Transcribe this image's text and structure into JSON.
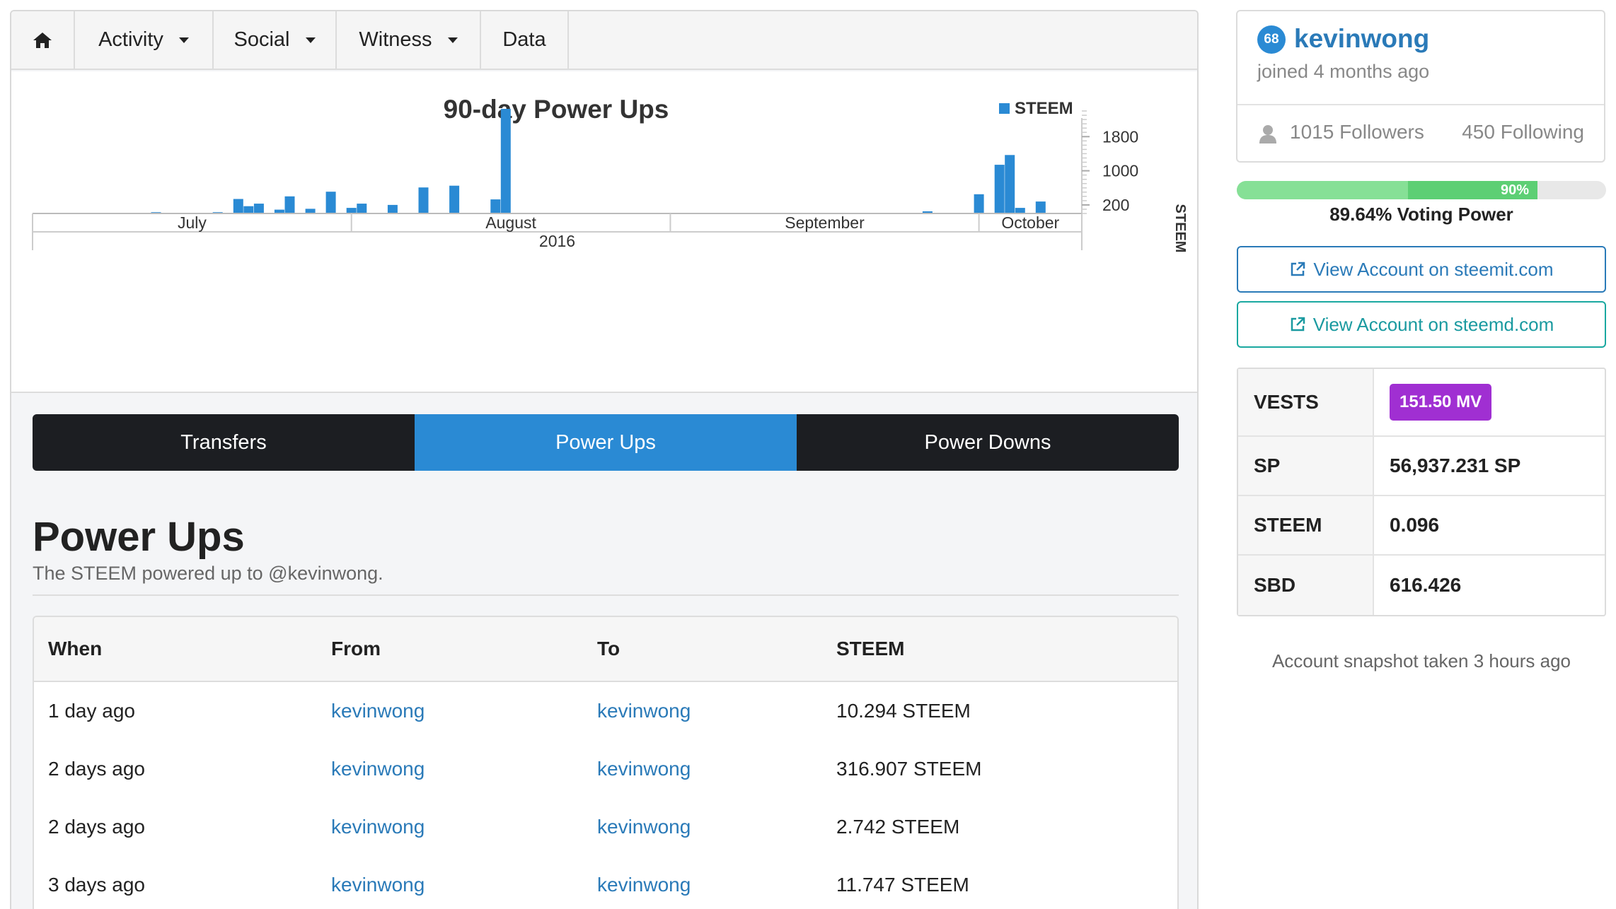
{
  "nav": {
    "home_icon": "home-icon",
    "items": [
      {
        "label": "Activity",
        "dropdown": true
      },
      {
        "label": "Social",
        "dropdown": true
      },
      {
        "label": "Witness",
        "dropdown": true
      },
      {
        "label": "Data",
        "dropdown": false
      }
    ]
  },
  "chart_data": {
    "type": "bar",
    "title": "90-day Power Ups",
    "legend": "STEEM",
    "legend_position": "top-right",
    "ylabel": "STEEM",
    "yticks": [
      200,
      1000,
      1800
    ],
    "ylim": [
      0,
      2500
    ],
    "x_month_labels": [
      "July",
      "August",
      "September",
      "October"
    ],
    "x_year_label": "2016",
    "x": [
      "2016-07-13",
      "2016-07-19",
      "2016-07-21",
      "2016-07-22",
      "2016-07-23",
      "2016-07-25",
      "2016-07-26",
      "2016-07-28",
      "2016-07-30",
      "2016-08-01",
      "2016-08-02",
      "2016-08-05",
      "2016-08-08",
      "2016-08-11",
      "2016-08-15",
      "2016-08-16",
      "2016-09-26",
      "2016-10-01",
      "2016-10-03",
      "2016-10-04",
      "2016-10-05",
      "2016-10-07"
    ],
    "values": [
      30,
      30,
      340,
      170,
      230,
      90,
      400,
      110,
      510,
      130,
      230,
      200,
      610,
      650,
      330,
      2450,
      50,
      450,
      1140,
      1370,
      130,
      280
    ],
    "color": "#2a8ad4",
    "grid": false
  },
  "tabs": [
    "Transfers",
    "Power Ups",
    "Power Downs"
  ],
  "active_tab": "Power Ups",
  "section": {
    "title": "Power Ups",
    "subtitle": "The STEEM powered up to @kevinwong."
  },
  "table": {
    "headers": [
      "When",
      "From",
      "To",
      "STEEM"
    ],
    "rows": [
      {
        "when": "1 day ago",
        "from": "kevinwong",
        "to": "kevinwong",
        "amount": "10.294 STEEM"
      },
      {
        "when": "2 days ago",
        "from": "kevinwong",
        "to": "kevinwong",
        "amount": "316.907 STEEM"
      },
      {
        "when": "2 days ago",
        "from": "kevinwong",
        "to": "kevinwong",
        "amount": "2.742 STEEM"
      },
      {
        "when": "3 days ago",
        "from": "kevinwong",
        "to": "kevinwong",
        "amount": "11.747 STEEM"
      }
    ]
  },
  "profile": {
    "reputation": "68",
    "username": "kevinwong",
    "joined": "joined 4 months ago",
    "followers": "1015 Followers",
    "following": "450 Following"
  },
  "voting_power": {
    "bar_label": "90%",
    "fill_fraction": 0.9,
    "label": "89.64% Voting Power"
  },
  "links": {
    "steemit": "View Account on steemit.com",
    "steemd": "View Account on steemd.com"
  },
  "stats": [
    {
      "key": "VESTS",
      "value": "151.50 MV",
      "badge": true
    },
    {
      "key": "SP",
      "value": "56,937.231 SP",
      "badge": false
    },
    {
      "key": "STEEM",
      "value": "0.096",
      "badge": false
    },
    {
      "key": "SBD",
      "value": "616.426",
      "badge": false
    }
  ],
  "snapshot": "Account snapshot taken 3 hours ago",
  "colors": {
    "accent": "#2a8ad4",
    "link": "#2a7ab8",
    "teal": "#1aa8a0",
    "vests_badge": "#a02fd2",
    "voting_fill": "#5dcf74"
  }
}
